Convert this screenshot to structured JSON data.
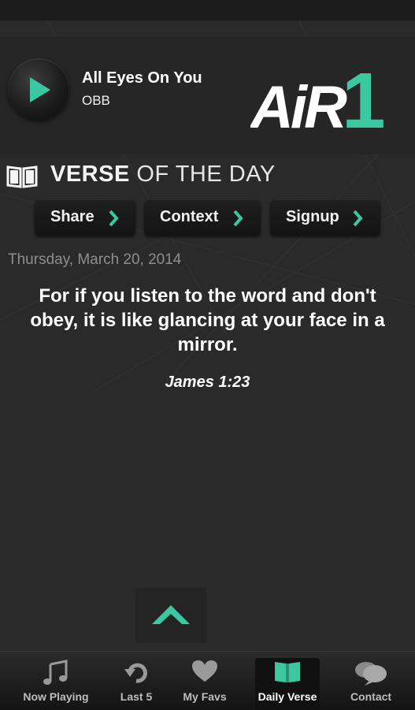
{
  "player": {
    "track_title": "All Eyes On You",
    "track_artist": "OBB",
    "play_icon": "play-icon",
    "logo_text": "AiR1"
  },
  "verse_of_the_day": {
    "header_bold": "VERSE",
    "header_light": "OF THE DAY",
    "actions": [
      {
        "label": "Share"
      },
      {
        "label": "Context"
      },
      {
        "label": "Signup"
      }
    ],
    "date": "Thursday, March 20, 2014",
    "text": "For if you listen to the word and don't obey, it is like glancing at your face in a mirror.",
    "reference": "James 1:23"
  },
  "tabs": [
    {
      "label": "Now Playing",
      "icon": "music-note-icon"
    },
    {
      "label": "Last 5",
      "icon": "history-arrow-icon"
    },
    {
      "label": "My Favs",
      "icon": "heart-icon"
    },
    {
      "label": "Daily Verse",
      "icon": "book-icon",
      "active": true
    },
    {
      "label": "Contact",
      "icon": "speech-bubbles-icon"
    }
  ],
  "colors": {
    "accent": "#3bc7a0",
    "background": "#2a2a2b",
    "button": "#1a1a1a"
  }
}
